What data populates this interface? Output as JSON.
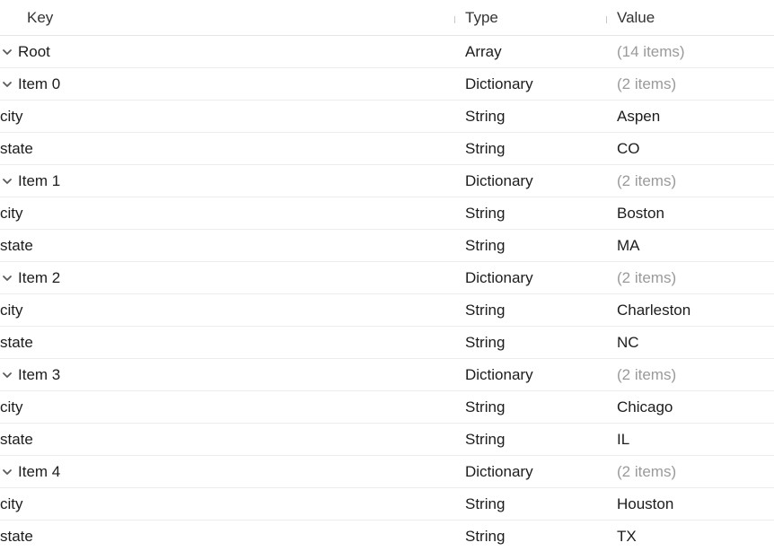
{
  "headers": {
    "key": "Key",
    "type": "Type",
    "value": "Value"
  },
  "root": {
    "key": "Root",
    "type": "Array",
    "value": "(14 items)"
  },
  "items": [
    {
      "key": "Item 0",
      "type": "Dictionary",
      "value": "(2 items)",
      "children": [
        {
          "key": "city",
          "type": "String",
          "value": "Aspen"
        },
        {
          "key": "state",
          "type": "String",
          "value": "CO"
        }
      ]
    },
    {
      "key": "Item 1",
      "type": "Dictionary",
      "value": "(2 items)",
      "children": [
        {
          "key": "city",
          "type": "String",
          "value": "Boston"
        },
        {
          "key": "state",
          "type": "String",
          "value": "MA"
        }
      ]
    },
    {
      "key": "Item 2",
      "type": "Dictionary",
      "value": "(2 items)",
      "children": [
        {
          "key": "city",
          "type": "String",
          "value": "Charleston"
        },
        {
          "key": "state",
          "type": "String",
          "value": "NC"
        }
      ]
    },
    {
      "key": "Item 3",
      "type": "Dictionary",
      "value": "(2 items)",
      "children": [
        {
          "key": "city",
          "type": "String",
          "value": "Chicago"
        },
        {
          "key": "state",
          "type": "String",
          "value": "IL"
        }
      ]
    },
    {
      "key": "Item 4",
      "type": "Dictionary",
      "value": "(2 items)",
      "children": [
        {
          "key": "city",
          "type": "String",
          "value": "Houston"
        },
        {
          "key": "state",
          "type": "String",
          "value": "TX"
        }
      ]
    }
  ]
}
